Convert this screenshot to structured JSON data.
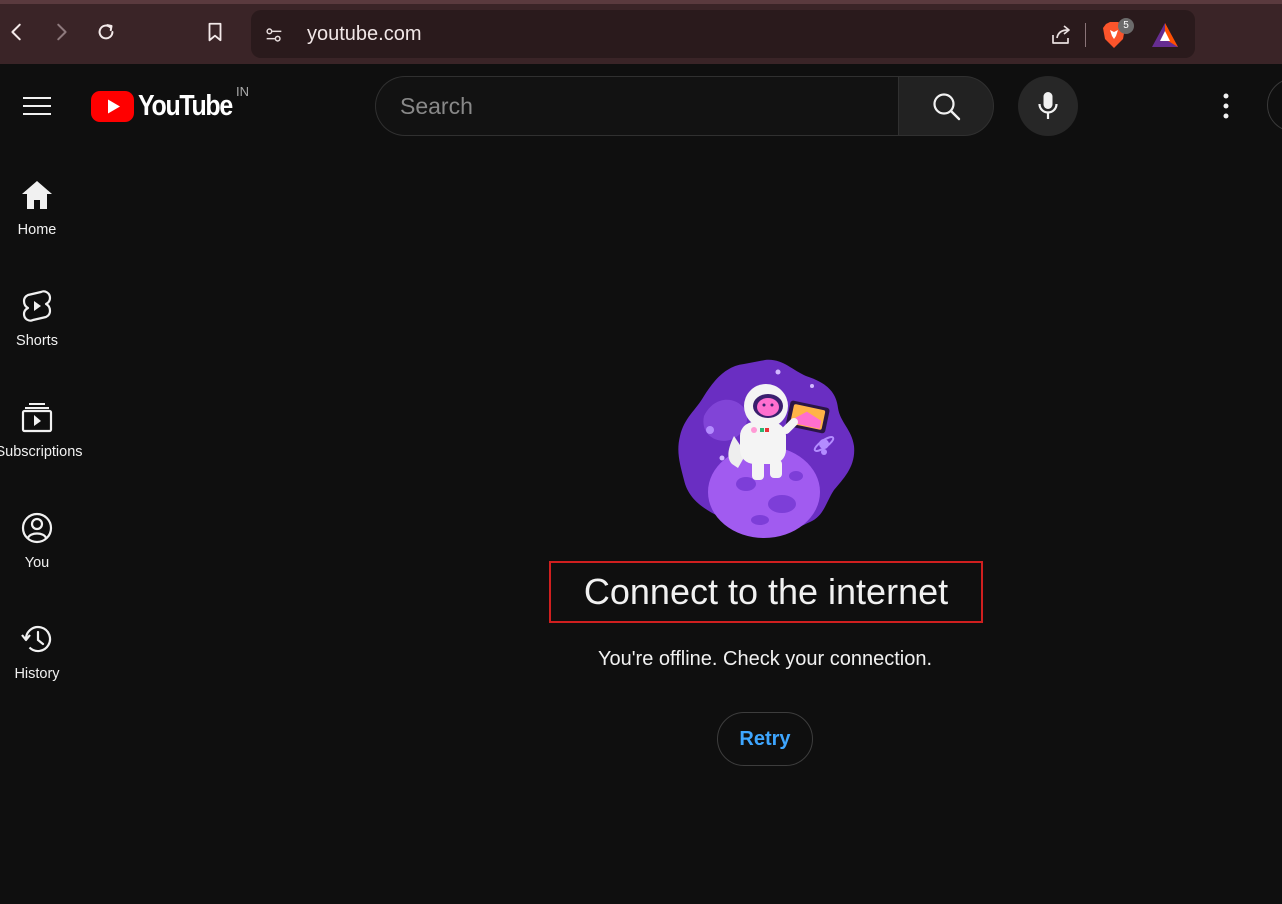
{
  "browser": {
    "url": "youtube.com",
    "brave_badge_count": "5"
  },
  "masthead": {
    "logo_text": "YouTube",
    "country_code": "IN",
    "search_placeholder": "Search"
  },
  "sidebar": {
    "items": [
      {
        "label": "Home",
        "icon": "home-icon"
      },
      {
        "label": "Shorts",
        "icon": "shorts-icon"
      },
      {
        "label": "Subscriptions",
        "icon": "subscriptions-icon"
      },
      {
        "label": "You",
        "icon": "you-icon"
      },
      {
        "label": "History",
        "icon": "history-icon"
      }
    ]
  },
  "offline": {
    "title": "Connect to the internet",
    "message": "You're offline. Check your connection.",
    "retry_label": "Retry"
  },
  "colors": {
    "youtube_red": "#ff0000",
    "link_blue": "#3ea6ff",
    "highlight_box": "#d01f1f",
    "background": "#0f0f0f"
  }
}
